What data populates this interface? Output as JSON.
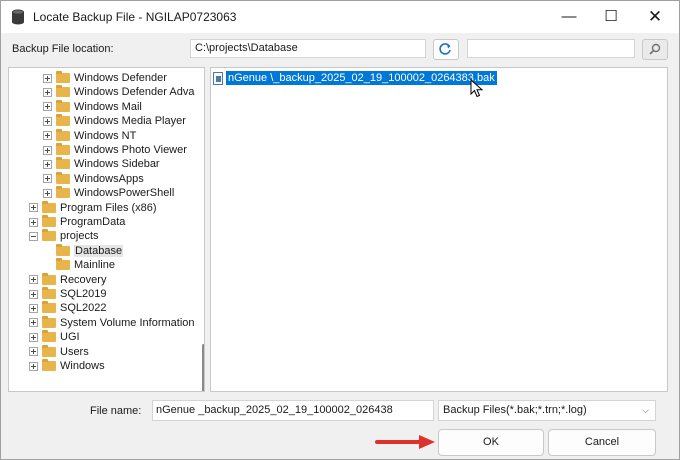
{
  "window": {
    "title": "Locate Backup File - NGILAP0723063",
    "icon": "database-icon",
    "controls": {
      "minimize": "—",
      "maximize": "☐",
      "close": "✕"
    }
  },
  "location": {
    "label": "Backup File location:",
    "path": "C:\\projects\\Database",
    "refresh_icon": "refresh-icon",
    "search_value": "",
    "search_icon": "search-icon"
  },
  "tree": {
    "items": [
      {
        "label": "Windows Defender",
        "expander": "plus",
        "selected": false
      },
      {
        "label": "Windows Defender Adva",
        "expander": "plus",
        "selected": false
      },
      {
        "label": "Windows Mail",
        "expander": "plus",
        "selected": false
      },
      {
        "label": "Windows Media Player",
        "expander": "plus",
        "selected": false
      },
      {
        "label": "Windows NT",
        "expander": "plus",
        "selected": false
      },
      {
        "label": "Windows Photo Viewer",
        "expander": "plus",
        "selected": false
      },
      {
        "label": "Windows Sidebar",
        "expander": "plus",
        "selected": false
      },
      {
        "label": "WindowsApps",
        "expander": "plus",
        "selected": false
      },
      {
        "label": "WindowsPowerShell",
        "expander": "plus",
        "selected": false
      },
      {
        "label": "Program Files (x86)",
        "expander": "plus",
        "selected": false
      },
      {
        "label": "ProgramData",
        "expander": "plus",
        "selected": false
      },
      {
        "label": "projects",
        "expander": "minus",
        "selected": false
      },
      {
        "label": "Database",
        "expander": "none",
        "selected": true
      },
      {
        "label": "Mainline",
        "expander": "none",
        "selected": false
      },
      {
        "label": "Recovery",
        "expander": "plus",
        "selected": false
      },
      {
        "label": "SQL2019",
        "expander": "plus",
        "selected": false
      },
      {
        "label": "SQL2022",
        "expander": "plus",
        "selected": false
      },
      {
        "label": "System Volume Information",
        "expander": "plus",
        "selected": false
      },
      {
        "label": "UGI",
        "expander": "plus",
        "selected": false
      },
      {
        "label": "Users",
        "expander": "plus",
        "selected": false
      },
      {
        "label": "Windows",
        "expander": "plus",
        "selected": false
      }
    ]
  },
  "files": [
    {
      "name": "nGenue          \\_backup_2025_02_19_100002_0264383.bak",
      "selected": true
    }
  ],
  "bottom": {
    "file_name_label": "File name:",
    "file_name_value": "nGenue               _backup_2025_02_19_100002_026438",
    "filter_value": "Backup Files(*.bak;*.trn;*.log)",
    "ok_label": "OK",
    "cancel_label": "Cancel"
  },
  "colors": {
    "selection": "#0078d7",
    "folder": "#e8b54a",
    "annotation_arrow": "#e0302a"
  }
}
